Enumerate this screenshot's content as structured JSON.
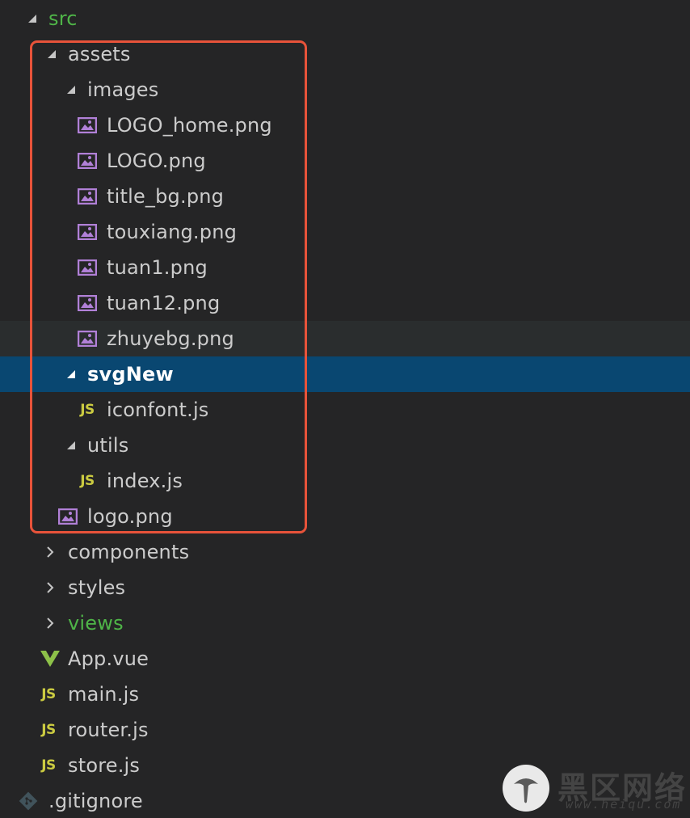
{
  "tree": {
    "items": [
      {
        "label": "src",
        "type": "folder",
        "expanded": true,
        "color": "#4fb548"
      },
      {
        "label": "assets",
        "type": "folder",
        "expanded": true
      },
      {
        "label": "images",
        "type": "folder",
        "expanded": true
      },
      {
        "label": "LOGO_home.png",
        "type": "image"
      },
      {
        "label": "LOGO.png",
        "type": "image"
      },
      {
        "label": "title_bg.png",
        "type": "image"
      },
      {
        "label": "touxiang.png",
        "type": "image"
      },
      {
        "label": "tuan1.png",
        "type": "image"
      },
      {
        "label": "tuan12.png",
        "type": "image"
      },
      {
        "label": "zhuyebg.png",
        "type": "image",
        "state": "hover"
      },
      {
        "label": "svgNew",
        "type": "folder",
        "expanded": true,
        "state": "selected"
      },
      {
        "label": "iconfont.js",
        "type": "js"
      },
      {
        "label": "utils",
        "type": "folder",
        "expanded": true
      },
      {
        "label": "index.js",
        "type": "js"
      },
      {
        "label": "logo.png",
        "type": "image"
      },
      {
        "label": "components",
        "type": "folder",
        "expanded": false
      },
      {
        "label": "styles",
        "type": "folder",
        "expanded": false
      },
      {
        "label": "views",
        "type": "folder",
        "expanded": false,
        "color": "#4fb548"
      },
      {
        "label": "App.vue",
        "type": "vue"
      },
      {
        "label": "main.js",
        "type": "js"
      },
      {
        "label": "router.js",
        "type": "js"
      },
      {
        "label": "store.js",
        "type": "js"
      },
      {
        "label": ".gitignore",
        "type": "git"
      }
    ]
  },
  "icons": {
    "js_text": "JS"
  },
  "colors": {
    "background": "#252526",
    "selected": "#094771",
    "hover": "#2a2d2e",
    "highlight_box": "#e8533a",
    "image_icon": "#b180d7",
    "js_icon": "#cbcb41",
    "vue_icon": "#8dc149",
    "git_icon": "#41535b",
    "text": "#cccccc",
    "green_text": "#4fb548"
  },
  "watermark": {
    "text": "黑区网络",
    "url": "www.heiqu.com"
  }
}
